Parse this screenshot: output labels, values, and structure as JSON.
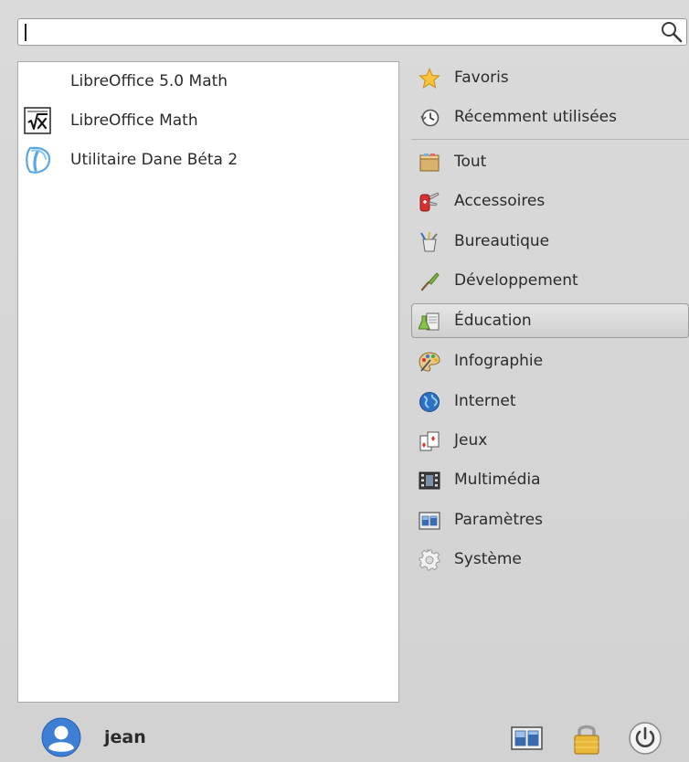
{
  "search": {
    "value": "",
    "placeholder": ""
  },
  "results": [
    {
      "label": "LibreOffice 5.0 Math",
      "icon": "none"
    },
    {
      "label": "LibreOffice Math",
      "icon": "libreoffice-math-icon"
    },
    {
      "label": "Utilitaire Dane Béta 2",
      "icon": "dane-utility-icon"
    }
  ],
  "categories": {
    "favorites": "Favoris",
    "recent": "Récemment utilisées",
    "all": "Tout",
    "accessories": "Accessoires",
    "office": "Bureautique",
    "development": "Développement",
    "education": "Éducation",
    "graphics": "Infographie",
    "internet": "Internet",
    "games": "Jeux",
    "multimedia": "Multimédia",
    "settings": "Paramètres",
    "system": "Système",
    "selected": "education"
  },
  "user": {
    "name": "jean"
  },
  "colors": {
    "accent": "#3e7fd6",
    "background": "#d4d4d4"
  }
}
